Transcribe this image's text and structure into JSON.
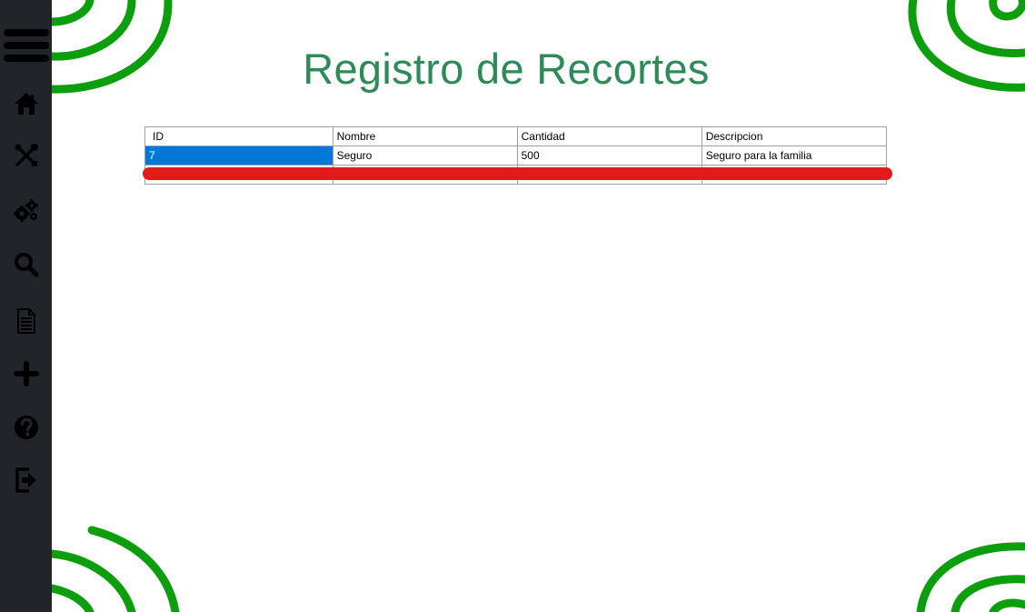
{
  "colors": {
    "sidebar": "#212529",
    "accent": "#2e8b57",
    "spiral": "#0c9e0c",
    "selection": "#0078d7",
    "mark": "#e21a1a"
  },
  "sidebar": {
    "items": [
      {
        "icon": "menu-icon"
      },
      {
        "icon": "home-icon"
      },
      {
        "icon": "tools-icon"
      },
      {
        "icon": "gears-icon"
      },
      {
        "icon": "search-icon"
      },
      {
        "icon": "document-icon"
      },
      {
        "icon": "plus-icon"
      },
      {
        "icon": "help-icon"
      },
      {
        "icon": "logout-icon"
      }
    ]
  },
  "page": {
    "title": "Registro de Recortes"
  },
  "table": {
    "headers": [
      "ID",
      "Nombre",
      "Cantidad",
      "Descripcion"
    ],
    "rows": [
      [
        "7",
        "Seguro",
        "500",
        "Seguro para la familia"
      ],
      [
        "",
        "",
        "",
        ""
      ]
    ]
  }
}
